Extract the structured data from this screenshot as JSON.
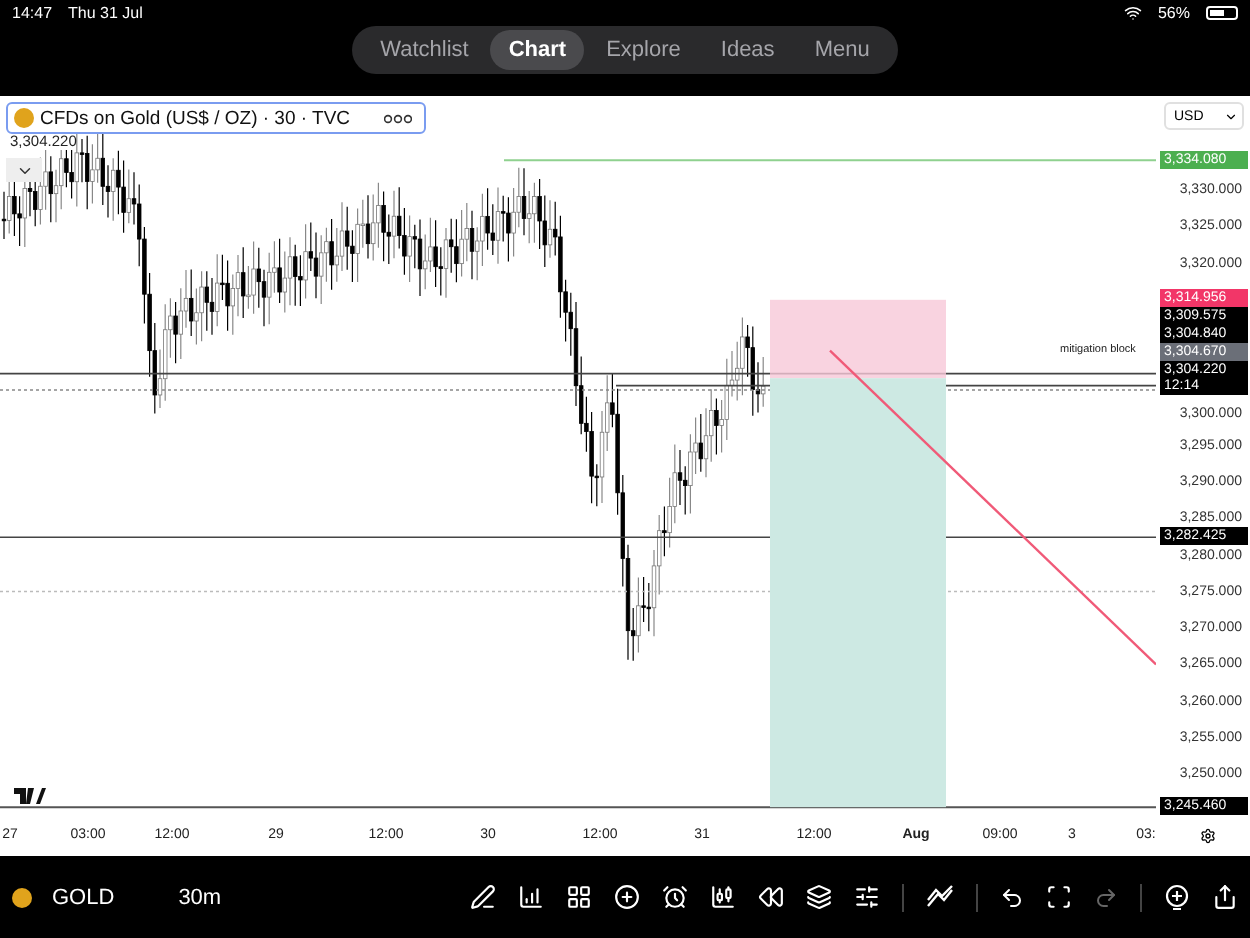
{
  "status_bar": {
    "time": "14:47",
    "date": "Thu 31 Jul",
    "battery": "56%"
  },
  "nav_tabs": [
    {
      "label": "Watchlist",
      "selected": false
    },
    {
      "label": "Chart",
      "selected": true
    },
    {
      "label": "Explore",
      "selected": false
    },
    {
      "label": "Ideas",
      "selected": false
    },
    {
      "label": "Menu",
      "selected": false
    }
  ],
  "chart": {
    "symbol": "CFDs on Gold (US$ / OZ) · 30 · TVC",
    "currency": "USD",
    "last_price": "3,304.220",
    "annotation": "mitigation block",
    "price_ticks": [
      "3,330.000",
      "3,325.000",
      "3,320.000",
      "3,300.000",
      "3,295.000",
      "3,290.000",
      "3,285.000",
      "3,280.000",
      "3,275.000",
      "3,270.000",
      "3,265.000",
      "3,260.000",
      "3,255.000",
      "3,250.000"
    ],
    "price_tags": [
      {
        "label": "3,334.080",
        "color": "#4caf50"
      },
      {
        "label": "3,314.956",
        "color": "#f23668"
      },
      {
        "label": "3,309.575",
        "color": "#000000"
      },
      {
        "label": "3,304.840",
        "color": "#000000"
      },
      {
        "label": "3,304.670",
        "color": "#6b6f78"
      },
      {
        "label": "3,304.220",
        "sublabel": "12:14",
        "color": "#000000"
      },
      {
        "label": "3,282.425",
        "color": "#000000"
      },
      {
        "label": "3,245.460",
        "color": "#000000"
      }
    ],
    "time_ticks": [
      {
        "label": "27",
        "kind": "day"
      },
      {
        "label": "03:00",
        "kind": "time"
      },
      {
        "label": "12:00",
        "kind": "time"
      },
      {
        "label": "29",
        "kind": "day"
      },
      {
        "label": "12:00",
        "kind": "time"
      },
      {
        "label": "30",
        "kind": "day"
      },
      {
        "label": "12:00",
        "kind": "time"
      },
      {
        "label": "31",
        "kind": "day"
      },
      {
        "label": "12:00",
        "kind": "time"
      },
      {
        "label": "Aug",
        "kind": "month"
      },
      {
        "label": "09:00",
        "kind": "time"
      },
      {
        "label": "3",
        "kind": "day"
      },
      {
        "label": "03:",
        "kind": "time"
      }
    ]
  },
  "toolbar": {
    "symbol": "GOLD",
    "interval": "30m",
    "redo_disabled": true
  }
}
